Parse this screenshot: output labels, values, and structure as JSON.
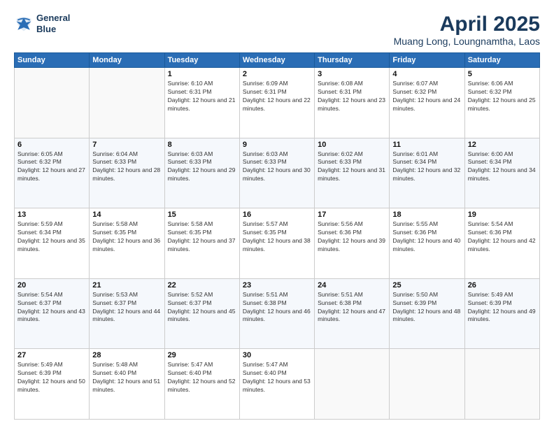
{
  "logo": {
    "line1": "General",
    "line2": "Blue"
  },
  "title": "April 2025",
  "location": "Muang Long, Loungnamtha, Laos",
  "weekdays": [
    "Sunday",
    "Monday",
    "Tuesday",
    "Wednesday",
    "Thursday",
    "Friday",
    "Saturday"
  ],
  "weeks": [
    [
      {
        "day": "",
        "sunrise": "",
        "sunset": "",
        "daylight": ""
      },
      {
        "day": "",
        "sunrise": "",
        "sunset": "",
        "daylight": ""
      },
      {
        "day": "1",
        "sunrise": "Sunrise: 6:10 AM",
        "sunset": "Sunset: 6:31 PM",
        "daylight": "Daylight: 12 hours and 21 minutes."
      },
      {
        "day": "2",
        "sunrise": "Sunrise: 6:09 AM",
        "sunset": "Sunset: 6:31 PM",
        "daylight": "Daylight: 12 hours and 22 minutes."
      },
      {
        "day": "3",
        "sunrise": "Sunrise: 6:08 AM",
        "sunset": "Sunset: 6:31 PM",
        "daylight": "Daylight: 12 hours and 23 minutes."
      },
      {
        "day": "4",
        "sunrise": "Sunrise: 6:07 AM",
        "sunset": "Sunset: 6:32 PM",
        "daylight": "Daylight: 12 hours and 24 minutes."
      },
      {
        "day": "5",
        "sunrise": "Sunrise: 6:06 AM",
        "sunset": "Sunset: 6:32 PM",
        "daylight": "Daylight: 12 hours and 25 minutes."
      }
    ],
    [
      {
        "day": "6",
        "sunrise": "Sunrise: 6:05 AM",
        "sunset": "Sunset: 6:32 PM",
        "daylight": "Daylight: 12 hours and 27 minutes."
      },
      {
        "day": "7",
        "sunrise": "Sunrise: 6:04 AM",
        "sunset": "Sunset: 6:33 PM",
        "daylight": "Daylight: 12 hours and 28 minutes."
      },
      {
        "day": "8",
        "sunrise": "Sunrise: 6:03 AM",
        "sunset": "Sunset: 6:33 PM",
        "daylight": "Daylight: 12 hours and 29 minutes."
      },
      {
        "day": "9",
        "sunrise": "Sunrise: 6:03 AM",
        "sunset": "Sunset: 6:33 PM",
        "daylight": "Daylight: 12 hours and 30 minutes."
      },
      {
        "day": "10",
        "sunrise": "Sunrise: 6:02 AM",
        "sunset": "Sunset: 6:33 PM",
        "daylight": "Daylight: 12 hours and 31 minutes."
      },
      {
        "day": "11",
        "sunrise": "Sunrise: 6:01 AM",
        "sunset": "Sunset: 6:34 PM",
        "daylight": "Daylight: 12 hours and 32 minutes."
      },
      {
        "day": "12",
        "sunrise": "Sunrise: 6:00 AM",
        "sunset": "Sunset: 6:34 PM",
        "daylight": "Daylight: 12 hours and 34 minutes."
      }
    ],
    [
      {
        "day": "13",
        "sunrise": "Sunrise: 5:59 AM",
        "sunset": "Sunset: 6:34 PM",
        "daylight": "Daylight: 12 hours and 35 minutes."
      },
      {
        "day": "14",
        "sunrise": "Sunrise: 5:58 AM",
        "sunset": "Sunset: 6:35 PM",
        "daylight": "Daylight: 12 hours and 36 minutes."
      },
      {
        "day": "15",
        "sunrise": "Sunrise: 5:58 AM",
        "sunset": "Sunset: 6:35 PM",
        "daylight": "Daylight: 12 hours and 37 minutes."
      },
      {
        "day": "16",
        "sunrise": "Sunrise: 5:57 AM",
        "sunset": "Sunset: 6:35 PM",
        "daylight": "Daylight: 12 hours and 38 minutes."
      },
      {
        "day": "17",
        "sunrise": "Sunrise: 5:56 AM",
        "sunset": "Sunset: 6:36 PM",
        "daylight": "Daylight: 12 hours and 39 minutes."
      },
      {
        "day": "18",
        "sunrise": "Sunrise: 5:55 AM",
        "sunset": "Sunset: 6:36 PM",
        "daylight": "Daylight: 12 hours and 40 minutes."
      },
      {
        "day": "19",
        "sunrise": "Sunrise: 5:54 AM",
        "sunset": "Sunset: 6:36 PM",
        "daylight": "Daylight: 12 hours and 42 minutes."
      }
    ],
    [
      {
        "day": "20",
        "sunrise": "Sunrise: 5:54 AM",
        "sunset": "Sunset: 6:37 PM",
        "daylight": "Daylight: 12 hours and 43 minutes."
      },
      {
        "day": "21",
        "sunrise": "Sunrise: 5:53 AM",
        "sunset": "Sunset: 6:37 PM",
        "daylight": "Daylight: 12 hours and 44 minutes."
      },
      {
        "day": "22",
        "sunrise": "Sunrise: 5:52 AM",
        "sunset": "Sunset: 6:37 PM",
        "daylight": "Daylight: 12 hours and 45 minutes."
      },
      {
        "day": "23",
        "sunrise": "Sunrise: 5:51 AM",
        "sunset": "Sunset: 6:38 PM",
        "daylight": "Daylight: 12 hours and 46 minutes."
      },
      {
        "day": "24",
        "sunrise": "Sunrise: 5:51 AM",
        "sunset": "Sunset: 6:38 PM",
        "daylight": "Daylight: 12 hours and 47 minutes."
      },
      {
        "day": "25",
        "sunrise": "Sunrise: 5:50 AM",
        "sunset": "Sunset: 6:39 PM",
        "daylight": "Daylight: 12 hours and 48 minutes."
      },
      {
        "day": "26",
        "sunrise": "Sunrise: 5:49 AM",
        "sunset": "Sunset: 6:39 PM",
        "daylight": "Daylight: 12 hours and 49 minutes."
      }
    ],
    [
      {
        "day": "27",
        "sunrise": "Sunrise: 5:49 AM",
        "sunset": "Sunset: 6:39 PM",
        "daylight": "Daylight: 12 hours and 50 minutes."
      },
      {
        "day": "28",
        "sunrise": "Sunrise: 5:48 AM",
        "sunset": "Sunset: 6:40 PM",
        "daylight": "Daylight: 12 hours and 51 minutes."
      },
      {
        "day": "29",
        "sunrise": "Sunrise: 5:47 AM",
        "sunset": "Sunset: 6:40 PM",
        "daylight": "Daylight: 12 hours and 52 minutes."
      },
      {
        "day": "30",
        "sunrise": "Sunrise: 5:47 AM",
        "sunset": "Sunset: 6:40 PM",
        "daylight": "Daylight: 12 hours and 53 minutes."
      },
      {
        "day": "",
        "sunrise": "",
        "sunset": "",
        "daylight": ""
      },
      {
        "day": "",
        "sunrise": "",
        "sunset": "",
        "daylight": ""
      },
      {
        "day": "",
        "sunrise": "",
        "sunset": "",
        "daylight": ""
      }
    ]
  ]
}
